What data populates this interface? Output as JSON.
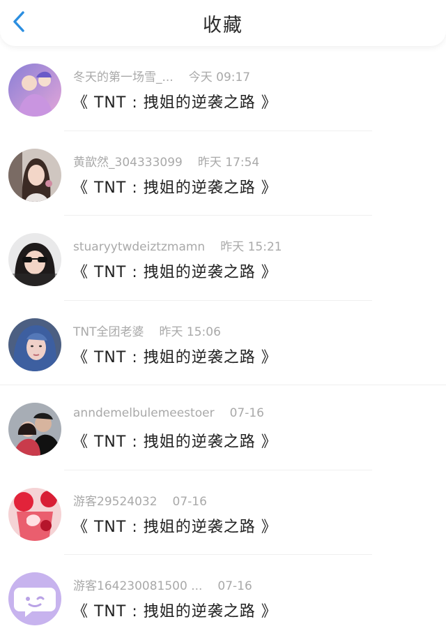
{
  "header": {
    "title": "收藏",
    "back_icon": "chevron-left-icon",
    "accent": "#2b8ee0"
  },
  "favorites": [
    {
      "user": "冬天的第一场雪_...",
      "time": "今天 09:17",
      "title": "《 TNT : 拽姐的逆袭之路 》",
      "avatar": "anime-girl-avatar"
    },
    {
      "user": "黄歆然_304333099",
      "time": "昨天 17:54",
      "title": "《 TNT : 拽姐的逆袭之路 》",
      "avatar": "girl-photo-avatar"
    },
    {
      "user": "stuaryytwdeiztzmamn",
      "time": "昨天 15:21",
      "title": "《 TNT : 拽姐的逆袭之路 》",
      "avatar": "sunglasses-avatar"
    },
    {
      "user": "TNT全团老婆",
      "time": "昨天 15:06",
      "title": "《 TNT : 拽姐的逆袭之路 》",
      "avatar": "blue-hair-avatar"
    },
    {
      "user": "anndemelbulemeestoer",
      "time": "07-16",
      "title": "《 TNT : 拽姐的逆袭之路 》",
      "avatar": "couple-avatar"
    },
    {
      "user": "游客29524032",
      "time": "07-16",
      "title": "《 TNT : 拽姐的逆袭之路 》",
      "avatar": "strawberry-drink-avatar"
    },
    {
      "user": "游客164230081500 ...",
      "time": "07-16",
      "title": "《 TNT : 拽姐的逆袭之路 》",
      "avatar": "default-chat-avatar"
    }
  ]
}
